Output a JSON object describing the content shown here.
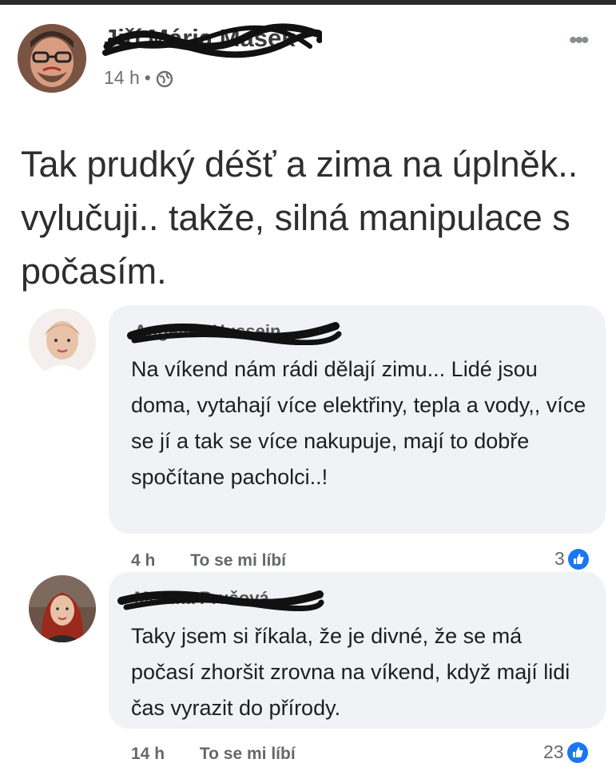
{
  "post": {
    "author": "Jiří Mária Mašek",
    "time": "14 h",
    "separator": "•",
    "text": "Tak prudký déšť a zima na úplněk.. vylučuji.. takže, silná manipulace s počasím.",
    "more_icon": "more-horizontal-icon",
    "privacy_icon": "globe-icon"
  },
  "comments": [
    {
      "author": "Angelika Hussein",
      "text": "Na víkend nám rádi dělají zimu... Lidé jsou doma, vytahají více elektřiny, tepla a vody,, více se jí a tak se více nakupuje, mají to dobře spočítane pacholci..!",
      "time": "4 h",
      "like_label": "To se mi líbí",
      "reactions": "3"
    },
    {
      "author": "Monika Prušová",
      "text": "Taky jsem si říkala, že je divné, že se má počasí zhoršit zrovna na víkend, když mají lidi čas vyrazit do přírody.",
      "time": "14 h",
      "like_label": "To se mi líbí",
      "reactions": "23"
    }
  ],
  "colors": {
    "bubble": "#f0f2f5",
    "like_blue": "#1877f2",
    "meta_gray": "#65676b"
  }
}
